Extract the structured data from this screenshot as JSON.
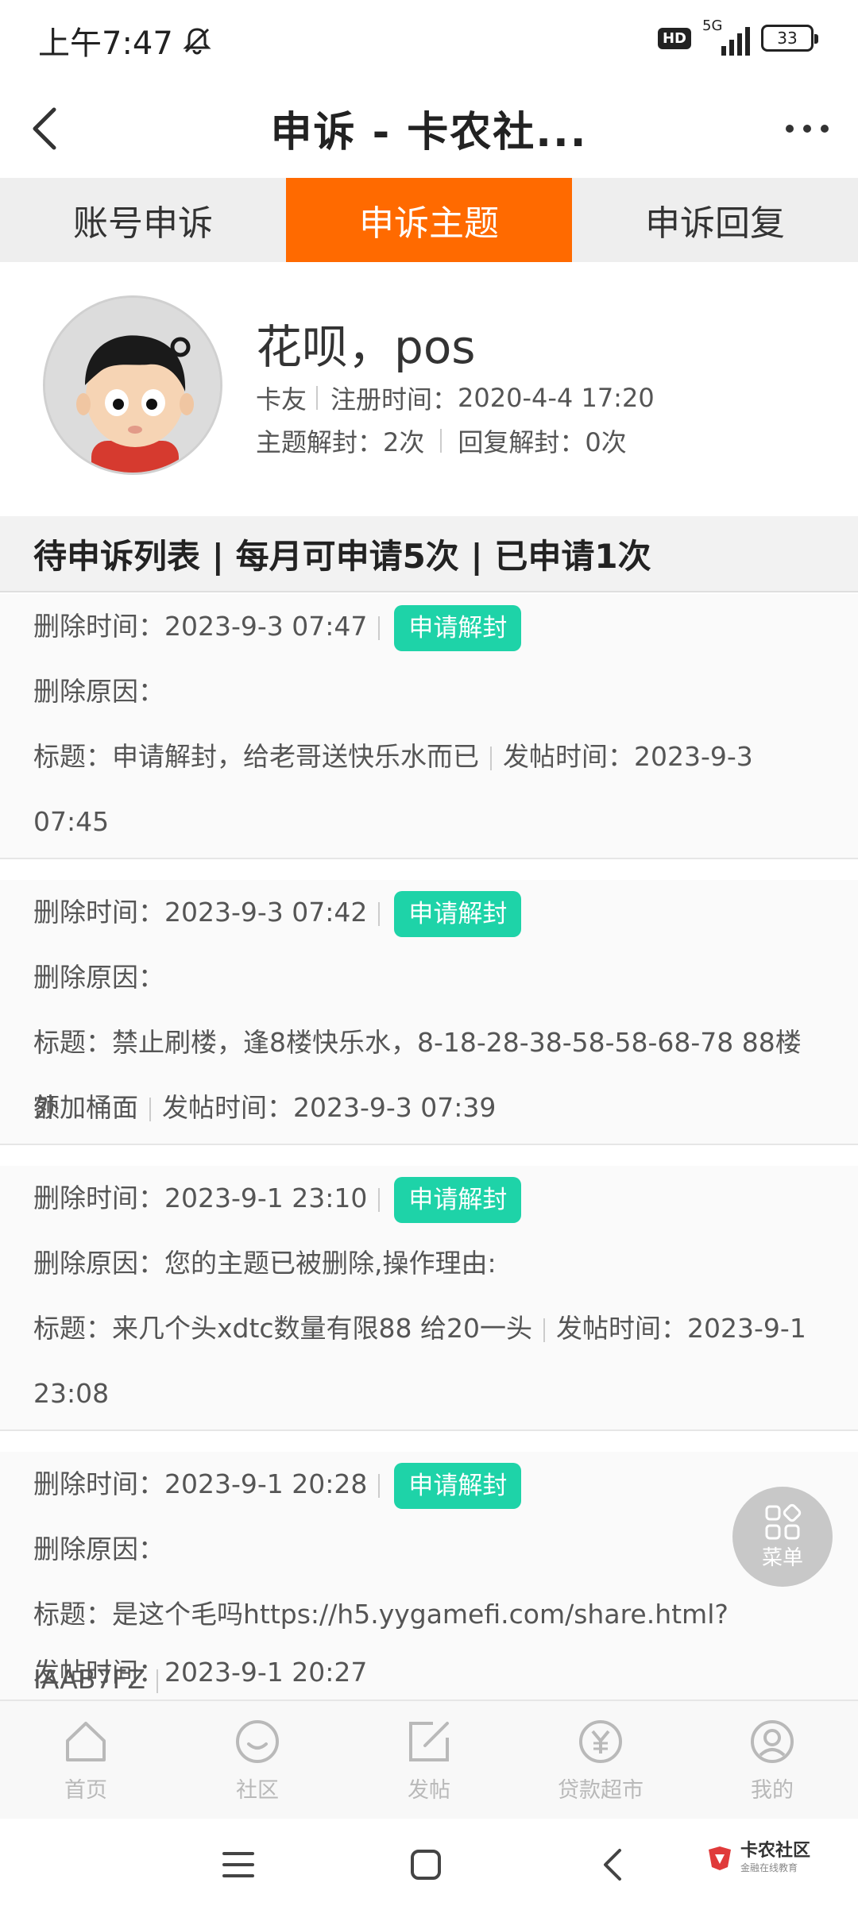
{
  "status_bar": {
    "time": "上午7:47",
    "hd": "HD",
    "network": "5G",
    "battery": "33"
  },
  "nav": {
    "title": "申诉 - 卡农社..."
  },
  "tabs": [
    {
      "label": "账号申诉",
      "active": false
    },
    {
      "label": "申诉主题",
      "active": true
    },
    {
      "label": "申诉回复",
      "active": false
    }
  ],
  "profile": {
    "name": "花呗，pos",
    "role": "卡友",
    "register_label": "注册时间：",
    "register_time": "2020-4-4 17:20",
    "topic_unseal": "主题解封：2次",
    "reply_unseal": "回复解封：0次"
  },
  "list_header": "待申诉列表 | 每月可申请5次 | 已申请1次",
  "records": [
    {
      "delete_time": "删除时间：2023-9-3 07:47",
      "button": "申请解封",
      "reason": "删除原因：",
      "title_line": "标题：申请解封，给老哥送快乐水而已",
      "post_time_inline": "发帖时间：2023-9-3",
      "continuation": "07:45"
    },
    {
      "delete_time": "删除时间：2023-9-3 07:42",
      "button": "申请解封",
      "reason": "删除原因：",
      "title_line": "标题：禁止刷楼，逢8楼快乐水，8-18-28-38-58-58-68-78 88楼额",
      "post_time_inline": "",
      "continuation": "外加桶面",
      "continuation_post_time": "发帖时间：2023-9-3 07:39"
    },
    {
      "delete_time": "删除时间：2023-9-1 23:10",
      "button": "申请解封",
      "reason": "删除原因：您的主题已被删除,操作理由:",
      "title_line": "标题：来几个头xdtc数量有限88 给20一头",
      "post_time_inline": "发帖时间：2023-9-1",
      "continuation": "23:08"
    },
    {
      "delete_time": "删除时间：2023-9-1 20:28",
      "button": "申请解封",
      "reason": "删除原因：",
      "title_line": "标题：是这个毛吗https://h5.yygamefi.com/share.html?IAAB7FZ",
      "post_time_inline": "",
      "continuation": "发帖时间：2023-9-1 20:27"
    }
  ],
  "float_menu": {
    "label": "菜单"
  },
  "bottom_nav": [
    {
      "label": "首页",
      "icon": "home-icon"
    },
    {
      "label": "社区",
      "icon": "community-icon"
    },
    {
      "label": "发帖",
      "icon": "compose-icon"
    },
    {
      "label": "贷款超市",
      "icon": "yen-icon"
    },
    {
      "label": "我的",
      "icon": "profile-icon"
    }
  ],
  "brand": {
    "name": "卡农社区",
    "sub": "金融在线教育"
  },
  "colors": {
    "accent": "#ff6a00",
    "button": "#1ed3a8"
  }
}
